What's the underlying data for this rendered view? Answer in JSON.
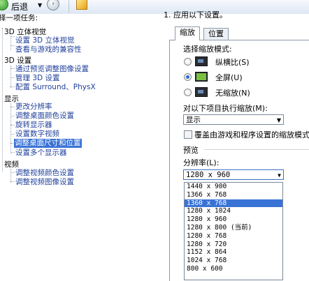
{
  "toolbar": {
    "back_label": "后退",
    "forward_symbol": "›"
  },
  "tree": {
    "header": "择一项任务:",
    "categories": [
      {
        "label": "3D 立体视觉",
        "items": [
          "设置 3D 立体视觉",
          "查看与游戏的兼容性"
        ]
      },
      {
        "label": "3D 设置",
        "items": [
          "通过预览调整图像设置",
          "管理 3D 设置",
          "配置 Surround、PhysX"
        ]
      },
      {
        "label": "显示",
        "items": [
          "更改分辨率",
          "调整桌面颜色设置",
          "旋转显示器",
          "设置数字视频",
          "调整桌面尺寸和位置",
          "设置多个显示器"
        ]
      },
      {
        "label": "视频",
        "items": [
          "调整视频颜色设置",
          "调整视频图像设置"
        ]
      }
    ],
    "selected_item": "调整桌面尺寸和位置"
  },
  "content": {
    "section_title": "1. 应用以下设置。",
    "tabs": [
      {
        "label": "缩放",
        "active": true
      },
      {
        "label": "位置",
        "active": false
      }
    ],
    "scaling_mode_label": "选择缩放模式:",
    "radio_options": [
      {
        "label": "纵横比(S)",
        "checked": false
      },
      {
        "label": "全屏(U)",
        "checked": true
      },
      {
        "label": "无缩放(N)",
        "checked": false
      }
    ],
    "perform_scaling_label": "对以下项目执行缩放(M):",
    "perform_scaling_value": "显示",
    "override_checkbox_label": "覆盖由游戏和程序设置的缩放模式(O)",
    "override_checked": false,
    "preview_label": "预览",
    "resolution_label": "分辨率(L):",
    "resolution_value": "1280 x 960"
  },
  "dropdown": {
    "options": [
      "1440 x 900",
      "1366 x 768",
      "1360 x 768",
      "1280 x 1024",
      "1280 x 960",
      "1280 x 800 (当前)",
      "1280 x 768",
      "1280 x 720",
      "1152 x 864",
      "1024 x 768",
      "800 x 600"
    ],
    "highlighted": "1360 x 768"
  },
  "colors": {
    "selection": "#3a73d6",
    "link": "#1f3f9a"
  }
}
